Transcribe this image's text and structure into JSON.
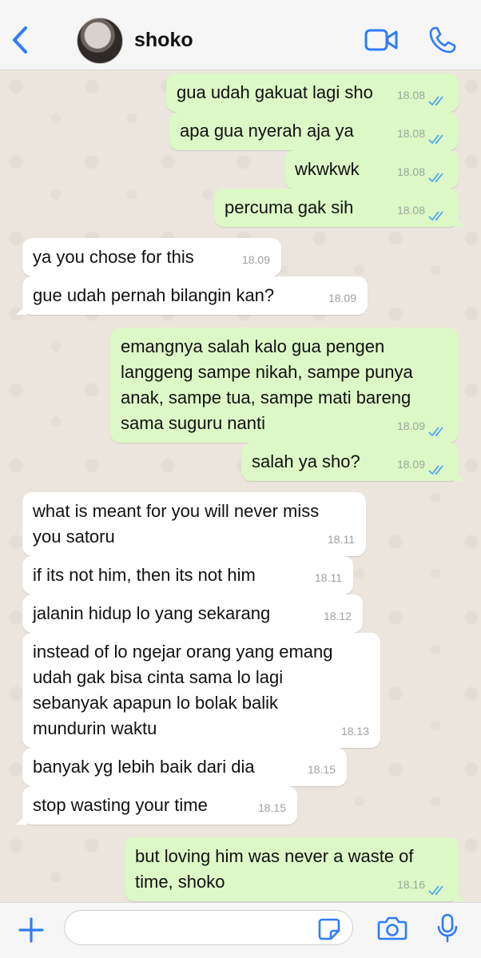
{
  "header": {
    "contact_name": "shoko",
    "accent": "#2f7cf6",
    "icons": [
      "chevron-left-icon",
      "avatar",
      "video-call-icon",
      "phone-icon"
    ]
  },
  "colors": {
    "outgoing_bubble": "#dcf8c6",
    "incoming_bubble": "#ffffff",
    "chat_background": "#ece5dd",
    "read_ticks": "#4fa8e8"
  },
  "messages": [
    {
      "dir": "out",
      "text": "gua udah gakuat lagi sho",
      "time": "18.08"
    },
    {
      "dir": "out",
      "text": "apa gua nyerah aja ya",
      "time": "18.08"
    },
    {
      "dir": "out",
      "text": "wkwkwk",
      "time": "18.08"
    },
    {
      "dir": "out",
      "text": "percuma gak sih",
      "time": "18.08"
    },
    {
      "dir": "in",
      "text": "ya you chose for this",
      "time": "18.09"
    },
    {
      "dir": "in",
      "text": "gue udah pernah bilangin kan?",
      "time": "18.09"
    },
    {
      "dir": "out",
      "text": "emangnya salah kalo gua pengen\nlanggeng sampe nikah, sampe punya\nanak, sampe tua, sampe mati bareng\nsama suguru nanti",
      "time": "18.09"
    },
    {
      "dir": "out",
      "text": "salah ya sho?",
      "time": "18.09"
    },
    {
      "dir": "in",
      "text": "what is meant for you will never miss\nyou satoru",
      "time": "18.11"
    },
    {
      "dir": "in",
      "text": "if its not him, then its not him",
      "time": "18.11"
    },
    {
      "dir": "in",
      "text": "jalanin hidup lo yang sekarang",
      "time": "18.12"
    },
    {
      "dir": "in",
      "text": "instead of lo ngejar orang yang emang\nudah gak bisa cinta sama lo lagi\nsebanyak apapun lo bolak balik\nmundurin waktu",
      "time": "18.13"
    },
    {
      "dir": "in",
      "text": "banyak yg lebih baik dari dia",
      "time": "18.15"
    },
    {
      "dir": "in",
      "text": "stop wasting your time",
      "time": "18.15"
    },
    {
      "dir": "out",
      "text": "but loving him was never a waste of\ntime, shoko",
      "time": "18.16"
    }
  ],
  "footer": {
    "input_value": "",
    "icons": [
      "plus-icon",
      "sticker-icon",
      "camera-icon",
      "microphone-icon"
    ]
  }
}
